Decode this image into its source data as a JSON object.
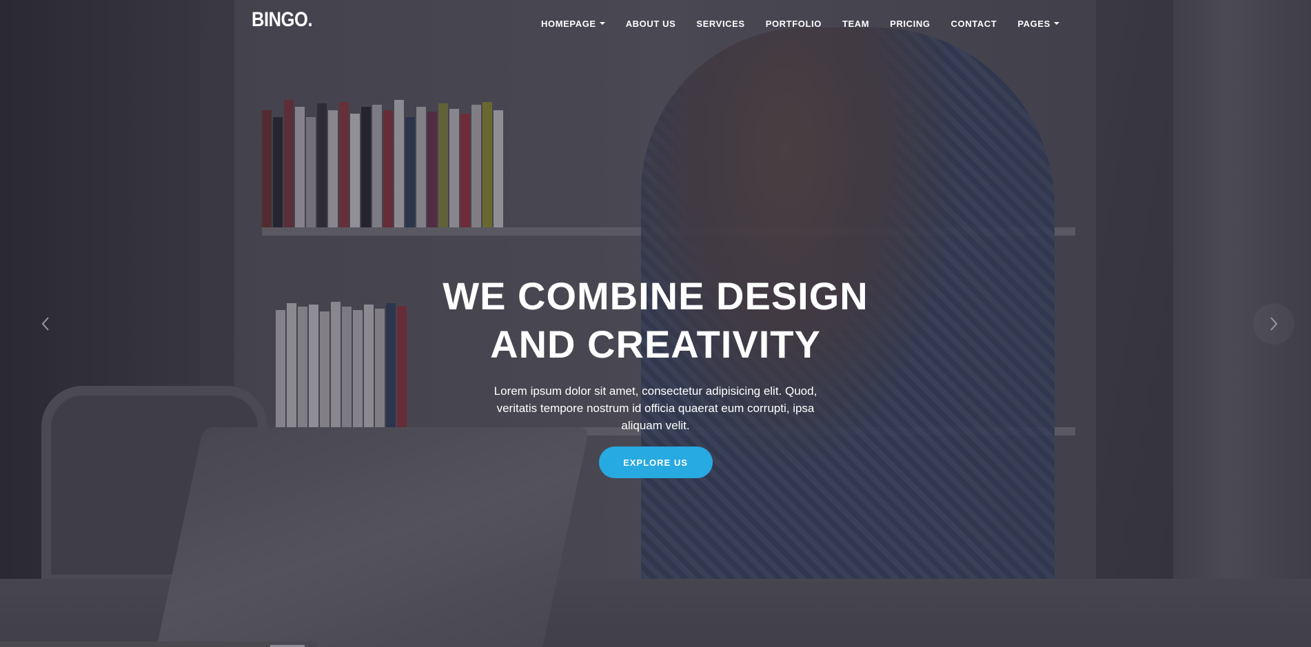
{
  "brand": {
    "logo": "BINGO."
  },
  "nav": {
    "items": [
      {
        "label": "HOMEPAGE",
        "dropdown": true
      },
      {
        "label": "ABOUT US",
        "dropdown": false
      },
      {
        "label": "SERVICES",
        "dropdown": false
      },
      {
        "label": "PORTFOLIO",
        "dropdown": false
      },
      {
        "label": "TEAM",
        "dropdown": false
      },
      {
        "label": "PRICING",
        "dropdown": false
      },
      {
        "label": "CONTACT",
        "dropdown": false
      },
      {
        "label": "PAGES",
        "dropdown": true
      }
    ]
  },
  "hero": {
    "title_line1": "WE COMBINE DESIGN",
    "title_line2": "AND CREATIVITY",
    "text": "Lorem ipsum dolor sit amet, consectetur adipisicing elit. Quod, veritatis tempore nostrum id officia quaerat eum corrupti, ipsa aliquam velit.",
    "cta_label": "EXPLORE US"
  },
  "carousel": {
    "prev_icon": "chevron-left-icon",
    "next_icon": "chevron-right-icon"
  },
  "colors": {
    "accent": "#27a9e1",
    "overlay": "#1e1c28"
  }
}
